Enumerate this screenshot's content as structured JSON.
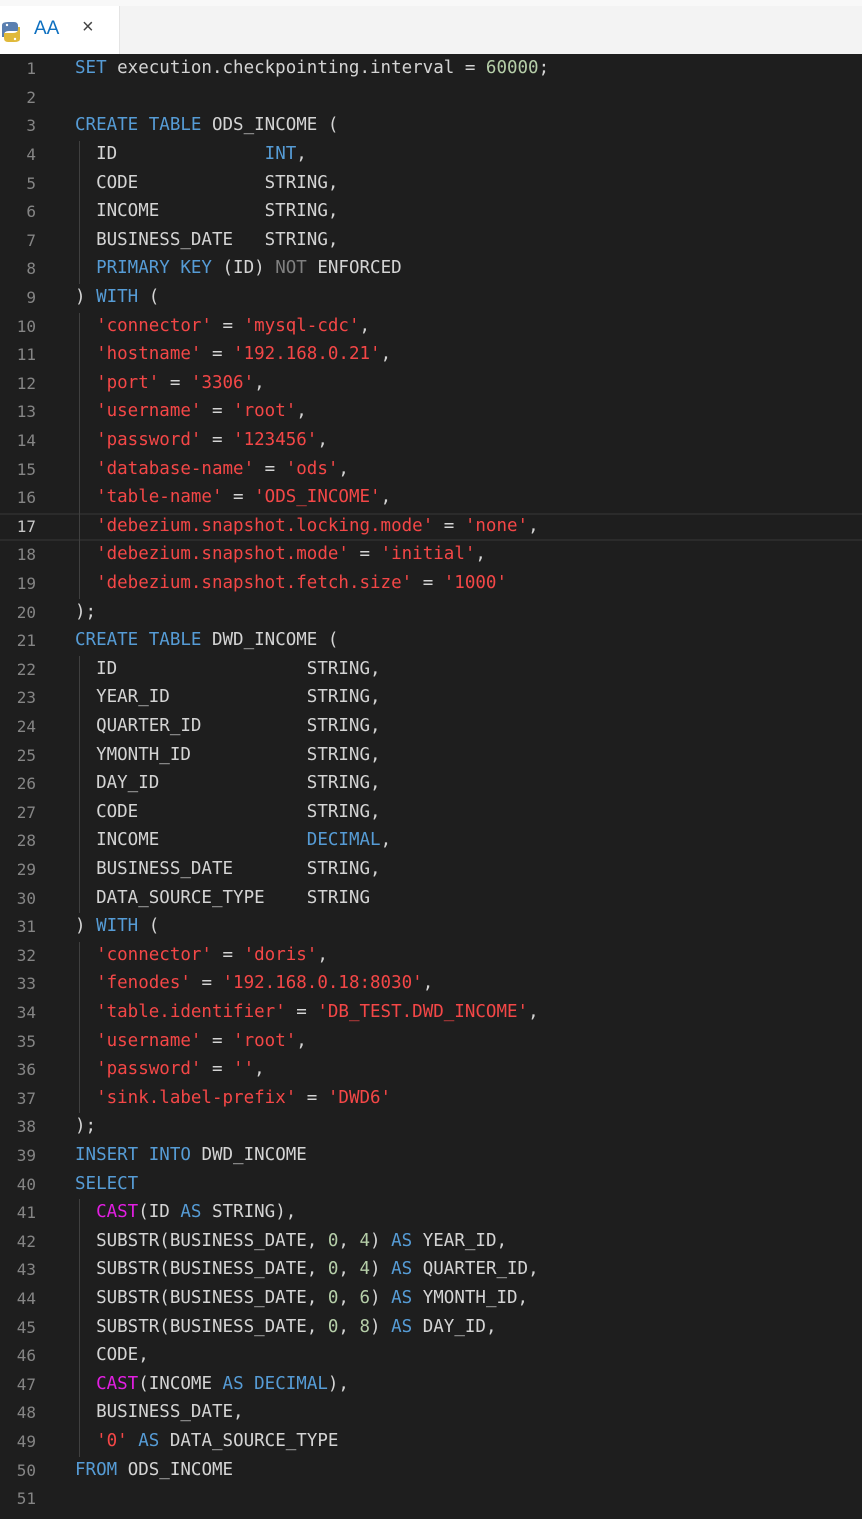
{
  "tab": {
    "title": "AA",
    "close": "×",
    "icon": "python-file-icon"
  },
  "colors": {
    "keyword": "#569cd6",
    "string": "#f44747",
    "function": "#e21ee2",
    "number": "#b5cea8",
    "text": "#d4d4d4",
    "line_number": "#858585",
    "background": "#1e1e1e"
  },
  "editor": {
    "current_line": 17,
    "lines": [
      [
        [
          "kw",
          "SET"
        ],
        [
          "t",
          " execution.checkpointing.interval = "
        ],
        [
          "num",
          "60000"
        ],
        [
          "t",
          ";"
        ]
      ],
      [],
      [
        [
          "kw",
          "CREATE TABLE"
        ],
        [
          "t",
          " ODS_INCOME ("
        ]
      ],
      [
        [
          "t",
          "  ID              "
        ],
        [
          "kw",
          "INT"
        ],
        [
          "t",
          ","
        ]
      ],
      [
        [
          "t",
          "  CODE            STRING,"
        ]
      ],
      [
        [
          "t",
          "  INCOME          STRING,"
        ]
      ],
      [
        [
          "t",
          "  BUSINESS_DATE   STRING,"
        ]
      ],
      [
        [
          "t",
          "  "
        ],
        [
          "kw",
          "PRIMARY KEY"
        ],
        [
          "t",
          " (ID) "
        ],
        [
          "gray",
          "NOT"
        ],
        [
          "t",
          " ENFORCED"
        ]
      ],
      [
        [
          "t",
          ") "
        ],
        [
          "kw",
          "WITH"
        ],
        [
          "t",
          " ("
        ]
      ],
      [
        [
          "t",
          "  "
        ],
        [
          "str",
          "'connector'"
        ],
        [
          "t",
          " = "
        ],
        [
          "str",
          "'mysql-cdc'"
        ],
        [
          "t",
          ","
        ]
      ],
      [
        [
          "t",
          "  "
        ],
        [
          "str",
          "'hostname'"
        ],
        [
          "t",
          " = "
        ],
        [
          "str",
          "'192.168.0.21'"
        ],
        [
          "t",
          ","
        ]
      ],
      [
        [
          "t",
          "  "
        ],
        [
          "str",
          "'port'"
        ],
        [
          "t",
          " = "
        ],
        [
          "str",
          "'3306'"
        ],
        [
          "t",
          ","
        ]
      ],
      [
        [
          "t",
          "  "
        ],
        [
          "str",
          "'username'"
        ],
        [
          "t",
          " = "
        ],
        [
          "str",
          "'root'"
        ],
        [
          "t",
          ","
        ]
      ],
      [
        [
          "t",
          "  "
        ],
        [
          "str",
          "'password'"
        ],
        [
          "t",
          " = "
        ],
        [
          "str",
          "'123456'"
        ],
        [
          "t",
          ","
        ]
      ],
      [
        [
          "t",
          "  "
        ],
        [
          "str",
          "'database-name'"
        ],
        [
          "t",
          " = "
        ],
        [
          "str",
          "'ods'"
        ],
        [
          "t",
          ","
        ]
      ],
      [
        [
          "t",
          "  "
        ],
        [
          "str",
          "'table-name'"
        ],
        [
          "t",
          " = "
        ],
        [
          "str",
          "'ODS_INCOME'"
        ],
        [
          "t",
          ","
        ]
      ],
      [
        [
          "t",
          "  "
        ],
        [
          "str",
          "'debezium.snapshot.locking.mode'"
        ],
        [
          "t",
          " = "
        ],
        [
          "str",
          "'none'"
        ],
        [
          "t",
          ","
        ]
      ],
      [
        [
          "t",
          "  "
        ],
        [
          "str",
          "'debezium.snapshot.mode'"
        ],
        [
          "t",
          " = "
        ],
        [
          "str",
          "'initial'"
        ],
        [
          "t",
          ","
        ]
      ],
      [
        [
          "t",
          "  "
        ],
        [
          "str",
          "'debezium.snapshot.fetch.size'"
        ],
        [
          "t",
          " = "
        ],
        [
          "str",
          "'1000'"
        ]
      ],
      [
        [
          "t",
          ");"
        ]
      ],
      [
        [
          "kw",
          "CREATE TABLE"
        ],
        [
          "t",
          " DWD_INCOME ("
        ]
      ],
      [
        [
          "t",
          "  ID                  STRING,"
        ]
      ],
      [
        [
          "t",
          "  YEAR_ID             STRING,"
        ]
      ],
      [
        [
          "t",
          "  QUARTER_ID          STRING,"
        ]
      ],
      [
        [
          "t",
          "  YMONTH_ID           STRING,"
        ]
      ],
      [
        [
          "t",
          "  DAY_ID              STRING,"
        ]
      ],
      [
        [
          "t",
          "  CODE                STRING,"
        ]
      ],
      [
        [
          "t",
          "  INCOME              "
        ],
        [
          "kw",
          "DECIMAL"
        ],
        [
          "t",
          ","
        ]
      ],
      [
        [
          "t",
          "  BUSINESS_DATE       STRING,"
        ]
      ],
      [
        [
          "t",
          "  DATA_SOURCE_TYPE    STRING"
        ]
      ],
      [
        [
          "t",
          ") "
        ],
        [
          "kw",
          "WITH"
        ],
        [
          "t",
          " ("
        ]
      ],
      [
        [
          "t",
          "  "
        ],
        [
          "str",
          "'connector'"
        ],
        [
          "t",
          " = "
        ],
        [
          "str",
          "'doris'"
        ],
        [
          "t",
          ","
        ]
      ],
      [
        [
          "t",
          "  "
        ],
        [
          "str",
          "'fenodes'"
        ],
        [
          "t",
          " = "
        ],
        [
          "str",
          "'192.168.0.18:8030'"
        ],
        [
          "t",
          ","
        ]
      ],
      [
        [
          "t",
          "  "
        ],
        [
          "str",
          "'table.identifier'"
        ],
        [
          "t",
          " = "
        ],
        [
          "str",
          "'DB_TEST.DWD_INCOME'"
        ],
        [
          "t",
          ","
        ]
      ],
      [
        [
          "t",
          "  "
        ],
        [
          "str",
          "'username'"
        ],
        [
          "t",
          " = "
        ],
        [
          "str",
          "'root'"
        ],
        [
          "t",
          ","
        ]
      ],
      [
        [
          "t",
          "  "
        ],
        [
          "str",
          "'password'"
        ],
        [
          "t",
          " = "
        ],
        [
          "str",
          "''"
        ],
        [
          "t",
          ","
        ]
      ],
      [
        [
          "t",
          "  "
        ],
        [
          "str",
          "'sink.label-prefix'"
        ],
        [
          "t",
          " = "
        ],
        [
          "str",
          "'DWD6'"
        ]
      ],
      [
        [
          "t",
          ");"
        ]
      ],
      [
        [
          "kw",
          "INSERT INTO"
        ],
        [
          "t",
          " DWD_INCOME"
        ]
      ],
      [
        [
          "kw",
          "SELECT"
        ]
      ],
      [
        [
          "t",
          "  "
        ],
        [
          "fn",
          "CAST"
        ],
        [
          "t",
          "(ID "
        ],
        [
          "kw",
          "AS"
        ],
        [
          "t",
          " STRING),"
        ]
      ],
      [
        [
          "t",
          "  SUBSTR(BUSINESS_DATE, "
        ],
        [
          "num",
          "0"
        ],
        [
          "t",
          ", "
        ],
        [
          "num",
          "4"
        ],
        [
          "t",
          ") "
        ],
        [
          "kw",
          "AS"
        ],
        [
          "t",
          " YEAR_ID,"
        ]
      ],
      [
        [
          "t",
          "  SUBSTR(BUSINESS_DATE, "
        ],
        [
          "num",
          "0"
        ],
        [
          "t",
          ", "
        ],
        [
          "num",
          "4"
        ],
        [
          "t",
          ") "
        ],
        [
          "kw",
          "AS"
        ],
        [
          "t",
          " QUARTER_ID,"
        ]
      ],
      [
        [
          "t",
          "  SUBSTR(BUSINESS_DATE, "
        ],
        [
          "num",
          "0"
        ],
        [
          "t",
          ", "
        ],
        [
          "num",
          "6"
        ],
        [
          "t",
          ") "
        ],
        [
          "kw",
          "AS"
        ],
        [
          "t",
          " YMONTH_ID,"
        ]
      ],
      [
        [
          "t",
          "  SUBSTR(BUSINESS_DATE, "
        ],
        [
          "num",
          "0"
        ],
        [
          "t",
          ", "
        ],
        [
          "num",
          "8"
        ],
        [
          "t",
          ") "
        ],
        [
          "kw",
          "AS"
        ],
        [
          "t",
          " DAY_ID,"
        ]
      ],
      [
        [
          "t",
          "  CODE,"
        ]
      ],
      [
        [
          "t",
          "  "
        ],
        [
          "fn",
          "CAST"
        ],
        [
          "t",
          "(INCOME "
        ],
        [
          "kw",
          "AS DECIMAL"
        ],
        [
          "t",
          "),"
        ]
      ],
      [
        [
          "t",
          "  BUSINESS_DATE,"
        ]
      ],
      [
        [
          "t",
          "  "
        ],
        [
          "str",
          "'0'"
        ],
        [
          "t",
          " "
        ],
        [
          "kw",
          "AS"
        ],
        [
          "t",
          " DATA_SOURCE_TYPE"
        ]
      ],
      [
        [
          "kw",
          "FROM"
        ],
        [
          "t",
          " ODS_INCOME"
        ]
      ],
      [],
      []
    ]
  }
}
